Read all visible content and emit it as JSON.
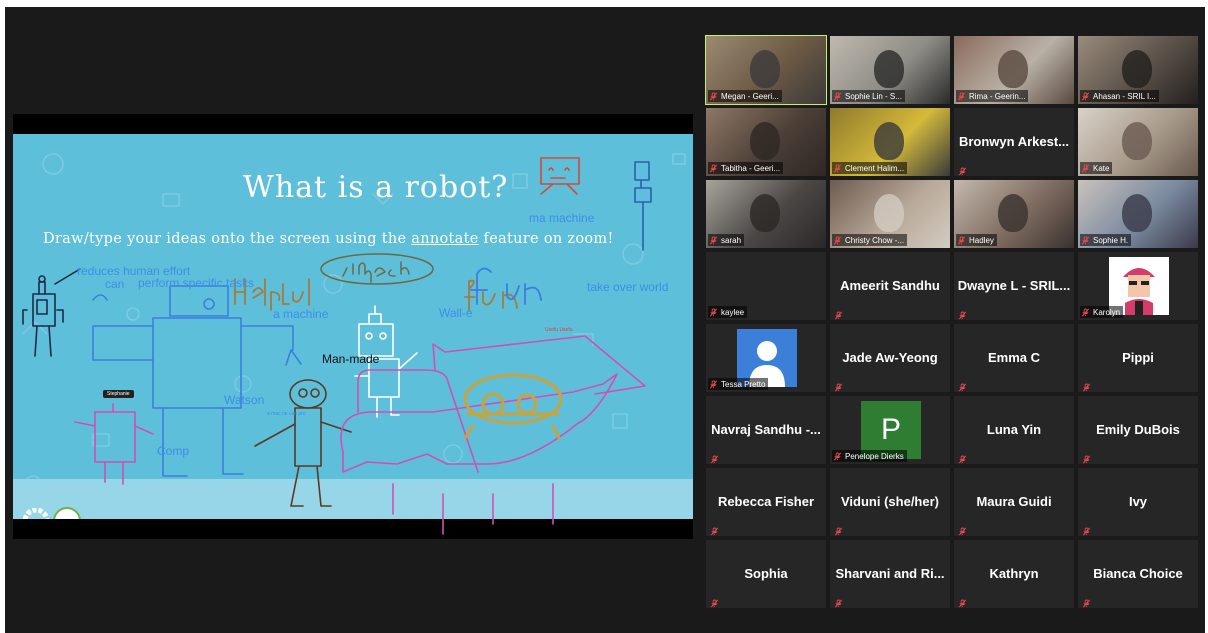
{
  "slide": {
    "title": "What is a robot?",
    "instructions_before": "Draw/type your ideas onto the screen using the ",
    "instructions_link": "annotate",
    "instructions_after": " feature on zoom!"
  },
  "annotations": {
    "can": "can",
    "perform": "perform specific tasks",
    "machine_top": "ma   machine",
    "reduces": "reduces human effort",
    "take_over": "take over world",
    "a_machine": "a machine",
    "walle": "Wall-e",
    "manmade": "Man-made",
    "watson": "Watson",
    "compu": "Comp",
    "stephanie": "Stephanie",
    "useful": "Usefu  Usefu",
    "small_note": "a mac   ne can   pro"
  },
  "gallery": [
    {
      "name": "Megan - Geeri...",
      "video": true,
      "active": true
    },
    {
      "name": "Sophie Lin - S...",
      "video": true
    },
    {
      "name": "Rima - Geerin...",
      "video": true
    },
    {
      "name": "Ahasan - SRIL I...",
      "video": true
    },
    {
      "name": "Tabitha - Geeri...",
      "video": true
    },
    {
      "name": "Clement Halim...",
      "video": true
    },
    {
      "name": "Bronwyn  Arkest...",
      "video": false
    },
    {
      "name": "Kate",
      "video": true
    },
    {
      "name": "sarah",
      "video": true
    },
    {
      "name": "Christy Chow -...",
      "video": true
    },
    {
      "name": "Hadley",
      "video": true
    },
    {
      "name": "Sophie H.",
      "video": true
    },
    {
      "name": "kaylee",
      "video": false,
      "corner": true
    },
    {
      "name": "Ameerit Sandhu",
      "video": false
    },
    {
      "name": "Dwayne L - SRIL...",
      "video": false
    },
    {
      "name": "Karolyn",
      "video": false,
      "avatar": "karolyn"
    },
    {
      "name": "Tessa Pretto",
      "video": false,
      "avatar": "person"
    },
    {
      "name": "Jade Aw-Yeong",
      "video": false
    },
    {
      "name": "Emma C",
      "video": false
    },
    {
      "name": "Pippi",
      "video": false
    },
    {
      "name": "Navraj Sandhu -...",
      "video": false
    },
    {
      "name": "Penelope Dierks",
      "video": false,
      "avatar": "letter",
      "initial": "P"
    },
    {
      "name": "Luna Yin",
      "video": false
    },
    {
      "name": "Emily DuBois",
      "video": false
    },
    {
      "name": "Rebecca Fisher",
      "video": false
    },
    {
      "name": "Viduni (she/her)",
      "video": false
    },
    {
      "name": "Maura Guidi",
      "video": false
    },
    {
      "name": "Ivy",
      "video": false
    },
    {
      "name": "Sophia",
      "video": false
    },
    {
      "name": "Sharvani and Ri...",
      "video": false
    },
    {
      "name": "Kathryn",
      "video": false
    },
    {
      "name": "Bianca Choice",
      "video": false
    }
  ],
  "colors": {
    "background": "#1a1a1a",
    "slide": "#5ebfdb",
    "active_speaker": "#c9f25a",
    "muted": "#e5484d",
    "avatar_blue": "#3c7fd8",
    "avatar_green": "#2e7d32"
  }
}
